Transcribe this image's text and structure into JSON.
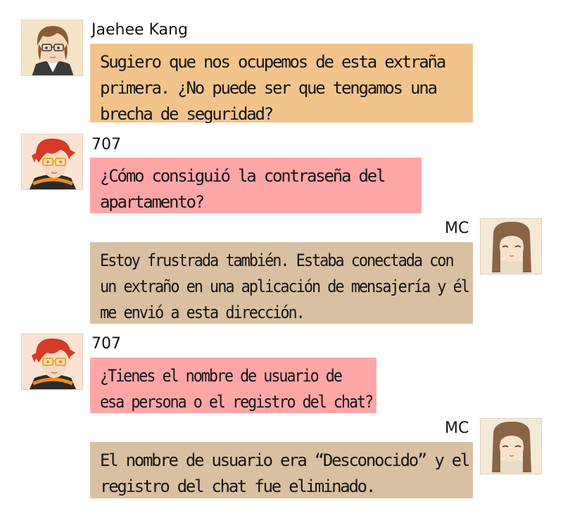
{
  "chat": {
    "messages": [
      {
        "sender": "Jaehee Kang",
        "avatar_icon": "jaehee-avatar-icon",
        "lines": [
          "Sugiero que nos ocupemos de esta extraña",
          "primera. ¿No puede ser que tengamos una",
          "brecha de seguridad?"
        ]
      },
      {
        "sender": "707",
        "avatar_icon": "707-avatar-icon",
        "lines": [
          "¿Cómo consiguió la contraseña del",
          "apartamento?"
        ]
      },
      {
        "sender": "MC",
        "avatar_icon": "mc-avatar-icon",
        "lines": [
          "Estoy frustrada también. Estaba conectada con",
          "un extraño en una aplicación de mensajería y él",
          "me envió a esta dirección."
        ]
      },
      {
        "sender": "707",
        "avatar_icon": "707-avatar-icon",
        "lines": [
          "¿Tienes el nombre de usuario de",
          "esa persona o el registro del chat?"
        ]
      },
      {
        "sender": "MC",
        "avatar_icon": "mc-avatar-icon",
        "lines": [
          "El nombre de usuario era “Desconocido” y el",
          "registro del chat fue eliminado."
        ]
      }
    ]
  },
  "colors": {
    "jaehee_bubble": "#f2c48c",
    "bubble_707": "#fea6a6",
    "mc_bubble": "#d8c0a2"
  }
}
